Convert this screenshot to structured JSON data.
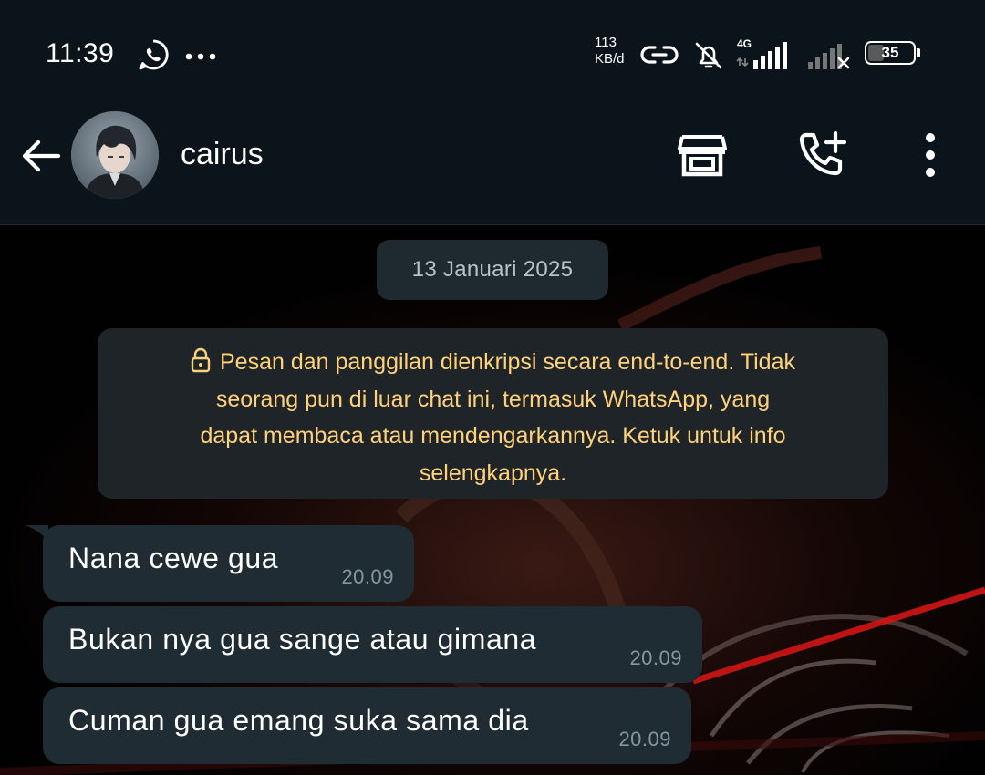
{
  "status_bar": {
    "time": "11:39",
    "net_speed_value": "113",
    "net_speed_unit": "KB/d",
    "network_type": "4G",
    "battery_percent": "35",
    "battery_level": 0.35,
    "icons": [
      "whatsapp-icon",
      "more-notifications-icon",
      "hotspot-icon",
      "notifications-muted-icon",
      "signal-4g-icon",
      "signal-no-service-icon",
      "battery-icon"
    ]
  },
  "header": {
    "contact_name": "cairus",
    "icons": [
      "back-arrow-icon",
      "avatar",
      "store-icon",
      "add-call-icon",
      "more-vertical-icon"
    ]
  },
  "chat": {
    "date_chip": "13 Januari 2025",
    "encryption_notice": {
      "lines": [
        "Pesan dan panggilan dienkripsi secara end-to-end. Tidak",
        "seorang pun di luar chat ini, termasuk WhatsApp, yang",
        "dapat membaca atau mendengarkannya. Ketuk untuk info",
        "selengkapnya."
      ],
      "icon": "lock-icon"
    },
    "messages": [
      {
        "text": "Nana cewe gua",
        "time": "20.09"
      },
      {
        "text": "Bukan nya gua sange atau gimana",
        "time": "20.09"
      },
      {
        "text": "Cuman gua emang suka sama dia",
        "time": "20.09"
      }
    ]
  },
  "colors": {
    "app_bar": "#0b141a",
    "bubble_incoming": "#1f2c33",
    "notice_text": "#ffd279",
    "timestamp": "#8696a0",
    "date_chip": "#1f2a30"
  }
}
